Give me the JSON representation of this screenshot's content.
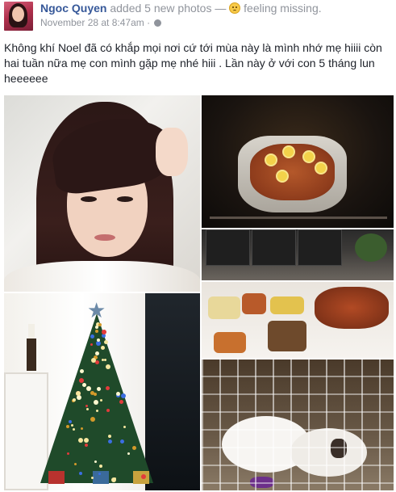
{
  "post": {
    "author": "Ngoc Quyen",
    "action": "added 5 new photos",
    "separator": "—",
    "feeling": "feeling missing.",
    "timestamp": "November 28 at 8:47am",
    "timestamp_separator": "·",
    "privacy_icon": "globe-icon",
    "feeling_icon": "sad-face-emoji",
    "text": "Không khí Noel đã có khắp mọi nơi cứ tới mùa này là mình nhớ mẹ hiiii còn hai tuần nữa mẹ con mình gặp mẹ nhé hiii . Lần này ở với con 5 tháng lun heeeeee"
  },
  "photos": [
    {
      "subject": "selfie"
    },
    {
      "subject": "oven-roast"
    },
    {
      "subject": "kitchen"
    },
    {
      "subject": "dinner-table"
    },
    {
      "subject": "christmas-tree"
    },
    {
      "subject": "dogs-in-pen"
    }
  ],
  "colors": {
    "author_link": "#365899",
    "meta_gray": "#90949c",
    "text": "#1d2129"
  }
}
